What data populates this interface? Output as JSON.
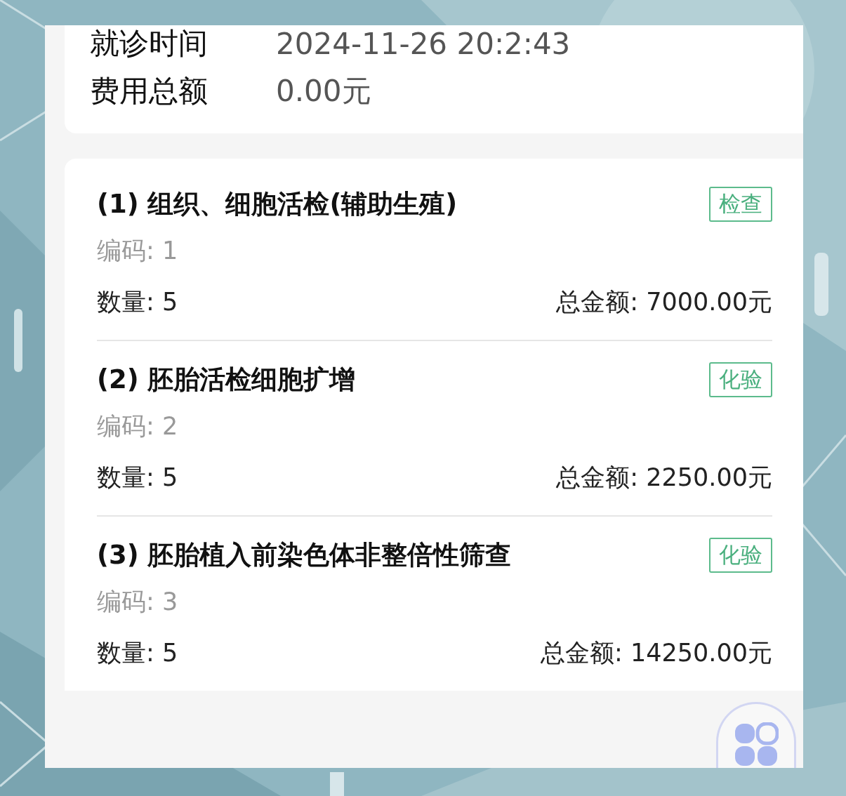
{
  "visit_info": [
    {
      "label": "就诊时间",
      "value": "2024-11-26 20:2:43"
    },
    {
      "label": "费用总额",
      "value": "0.00元"
    }
  ],
  "items": [
    {
      "title": "(1) 组织、细胞活检(辅助生殖)",
      "tag": "检查",
      "code": "编码: 1",
      "quantity": "数量: 5",
      "total": "总金额: 7000.00元"
    },
    {
      "title": "(2) 胚胎活检细胞扩增",
      "tag": "化验",
      "code": "编码: 2",
      "quantity": "数量: 5",
      "total": "总金额: 2250.00元"
    },
    {
      "title": "(3) 胚胎植入前染色体非整倍性筛查",
      "tag": "化验",
      "code": "编码: 3",
      "quantity": "数量: 5",
      "total": "总金额: 14250.00元"
    }
  ]
}
